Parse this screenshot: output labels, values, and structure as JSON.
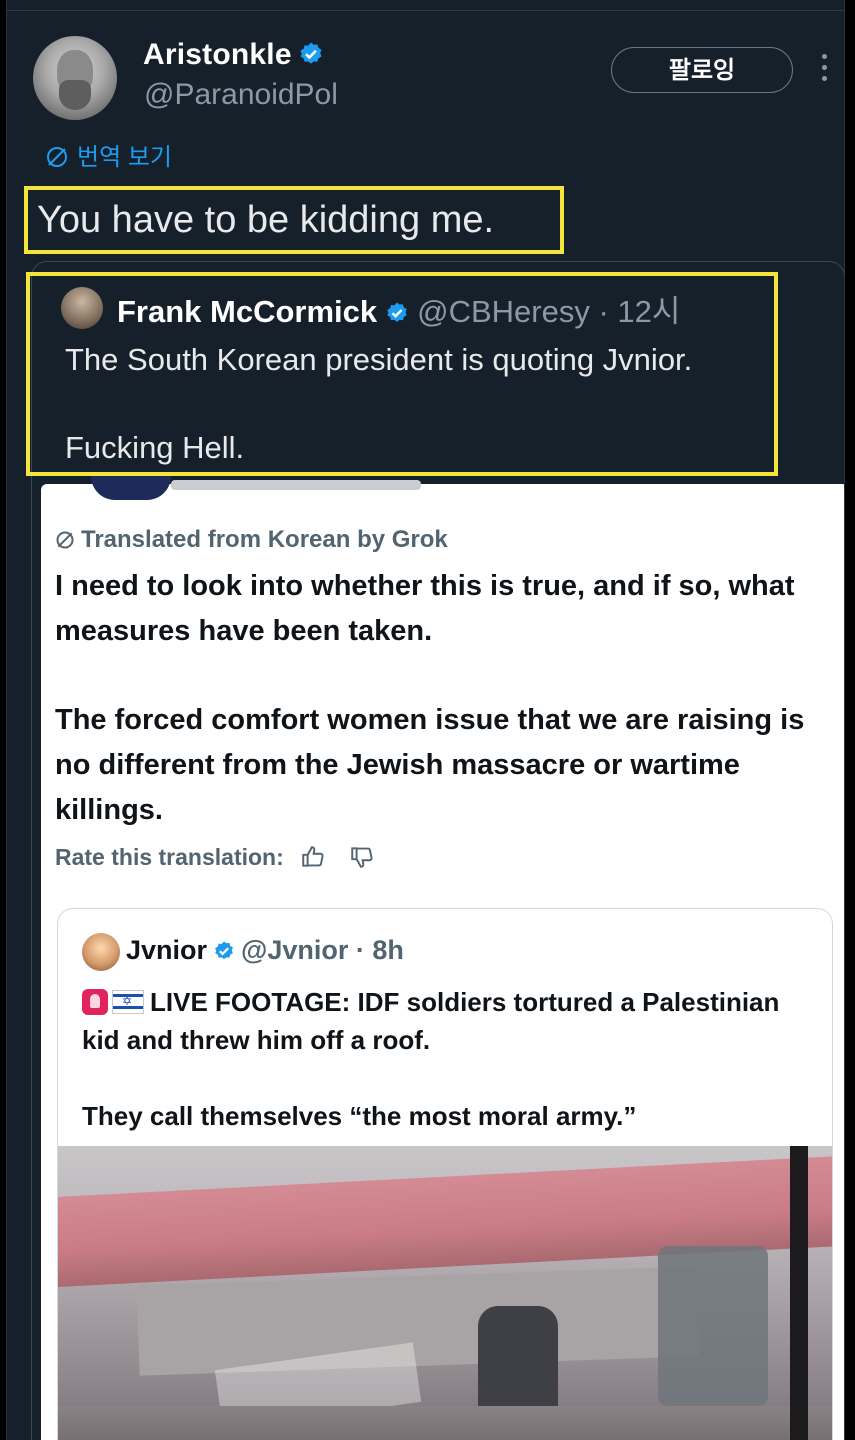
{
  "colors": {
    "background": "#15202b",
    "accent": "#1d9bf0",
    "highlight_box": "#f3e53a"
  },
  "tweet": {
    "author_name": "Aristonkle",
    "author_handle": "@ParanoidPol",
    "follow_label": "팔로잉",
    "translate_label": "번역 보기",
    "text": "You have to be kidding me."
  },
  "quote": {
    "author_name": "Frank McCormick",
    "author_handle": "@CBHeresy · 12시",
    "line1": "The South Korean president is quoting Jvnior.",
    "line2": "Fucking Hell."
  },
  "screenshot_card": {
    "translated_from": "Translated from Korean by Grok",
    "para1": "I need to look into whether this is true, and if so, what measures have been taken.",
    "para2": "The forced comfort women issue that we are raising is no different from the Jewish massacre or wartime killings.",
    "rate_label": "Rate this translation:",
    "inner": {
      "author_name": "Jvnior",
      "author_handle": "@Jvnior · 8h",
      "line1": "LIVE FOOTAGE: IDF soldiers tortured a Palestinian kid and threw him off a roof.",
      "line2": "They call themselves “the most moral army.”"
    }
  },
  "icons": [
    "verified-badge-icon",
    "more-options-icon",
    "translate-globe-icon",
    "thumbs-up-icon",
    "thumbs-down-icon",
    "siren-emoji",
    "israel-flag-emoji"
  ]
}
